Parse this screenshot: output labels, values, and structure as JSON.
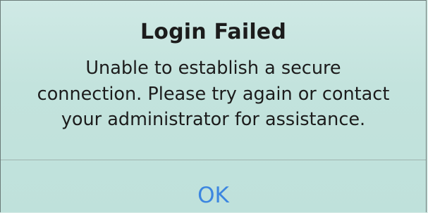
{
  "alert": {
    "title": "Login Failed",
    "message_lines": [
      "Unable to establish a secure",
      "connection. Please try again or contact",
      "your administrator for assistance."
    ],
    "button_label": "OK"
  },
  "colors": {
    "background": "#c3e3dd",
    "text": "#1c1c1c",
    "button_text": "#3c86e0",
    "divider": "#9fb3af"
  }
}
